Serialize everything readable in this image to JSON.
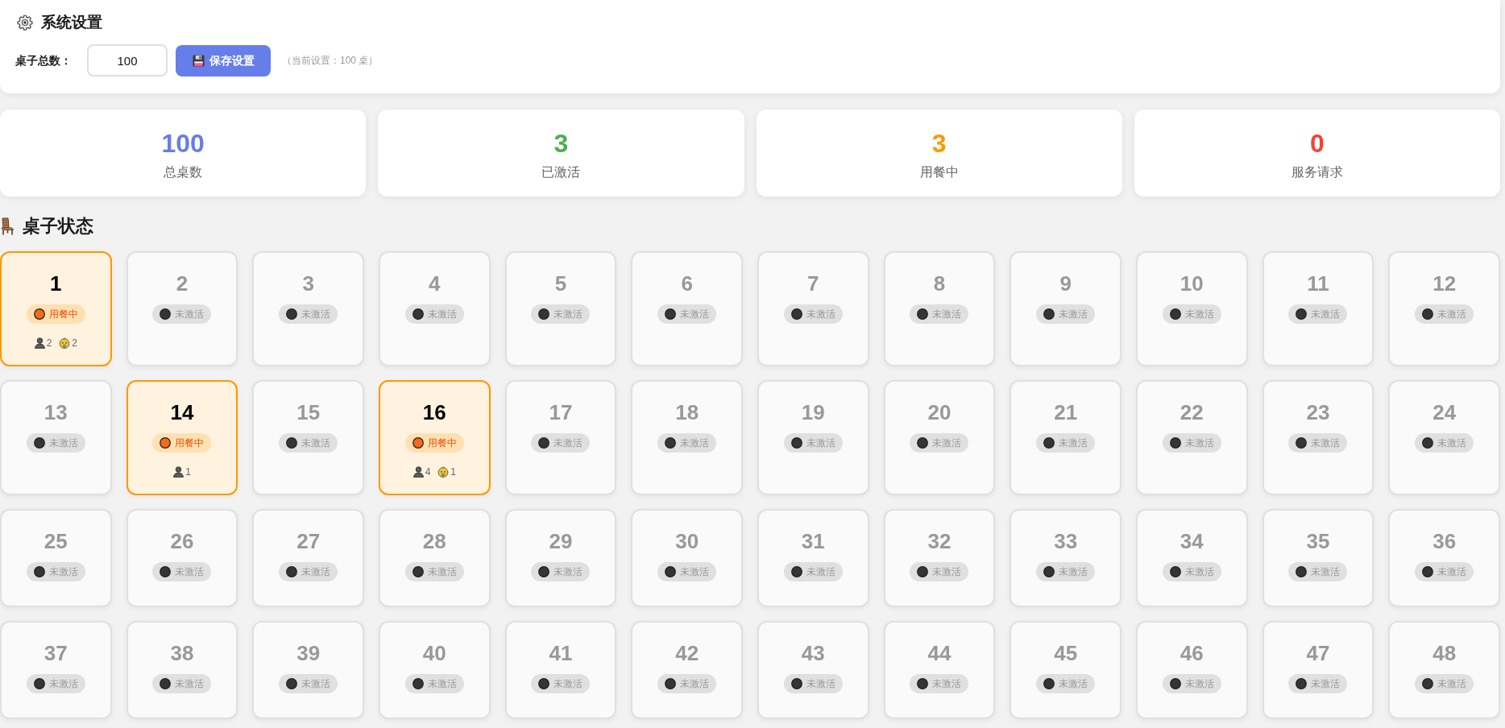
{
  "settings": {
    "title": "系统设置",
    "field_label": "桌子总数：",
    "field_value": "100",
    "save_button": "保存设置",
    "note": "（当前设置：100 桌）"
  },
  "stats": [
    {
      "value": "100",
      "label": "总桌数",
      "color": "#667eea"
    },
    {
      "value": "3",
      "label": "已激活",
      "color": "#4caf50"
    },
    {
      "value": "3",
      "label": "用餐中",
      "color": "#ff9800"
    },
    {
      "value": "0",
      "label": "服务请求",
      "color": "#f44336"
    }
  ],
  "tables_section": {
    "title": "桌子状态"
  },
  "tables": [
    {
      "number": "1",
      "kind": "occupied",
      "status_label": "用餐中",
      "guests": [
        {
          "kind": "adult",
          "count": "2"
        },
        {
          "kind": "child",
          "count": "2"
        }
      ]
    },
    {
      "number": "2",
      "kind": "inactive",
      "status_label": "未激活"
    },
    {
      "number": "3",
      "kind": "inactive",
      "status_label": "未激活"
    },
    {
      "number": "4",
      "kind": "inactive",
      "status_label": "未激活"
    },
    {
      "number": "5",
      "kind": "inactive",
      "status_label": "未激活"
    },
    {
      "number": "6",
      "kind": "inactive",
      "status_label": "未激活"
    },
    {
      "number": "7",
      "kind": "inactive",
      "status_label": "未激活"
    },
    {
      "number": "8",
      "kind": "inactive",
      "status_label": "未激活"
    },
    {
      "number": "9",
      "kind": "inactive",
      "status_label": "未激活"
    },
    {
      "number": "10",
      "kind": "inactive",
      "status_label": "未激活"
    },
    {
      "number": "11",
      "kind": "inactive",
      "status_label": "未激活"
    },
    {
      "number": "12",
      "kind": "inactive",
      "status_label": "未激活"
    },
    {
      "number": "13",
      "kind": "inactive",
      "status_label": "未激活"
    },
    {
      "number": "14",
      "kind": "occupied",
      "status_label": "用餐中",
      "guests": [
        {
          "kind": "adult",
          "count": "1"
        }
      ]
    },
    {
      "number": "15",
      "kind": "inactive",
      "status_label": "未激活"
    },
    {
      "number": "16",
      "kind": "occupied",
      "status_label": "用餐中",
      "guests": [
        {
          "kind": "adult",
          "count": "4"
        },
        {
          "kind": "child",
          "count": "1"
        }
      ]
    },
    {
      "number": "17",
      "kind": "inactive",
      "status_label": "未激活"
    },
    {
      "number": "18",
      "kind": "inactive",
      "status_label": "未激活"
    },
    {
      "number": "19",
      "kind": "inactive",
      "status_label": "未激活"
    },
    {
      "number": "20",
      "kind": "inactive",
      "status_label": "未激活"
    },
    {
      "number": "21",
      "kind": "inactive",
      "status_label": "未激活"
    },
    {
      "number": "22",
      "kind": "inactive",
      "status_label": "未激活"
    },
    {
      "number": "23",
      "kind": "inactive",
      "status_label": "未激活"
    },
    {
      "number": "24",
      "kind": "inactive",
      "status_label": "未激活"
    },
    {
      "number": "25",
      "kind": "inactive",
      "status_label": "未激活"
    },
    {
      "number": "26",
      "kind": "inactive",
      "status_label": "未激活"
    },
    {
      "number": "27",
      "kind": "inactive",
      "status_label": "未激活"
    },
    {
      "number": "28",
      "kind": "inactive",
      "status_label": "未激活"
    },
    {
      "number": "29",
      "kind": "inactive",
      "status_label": "未激活"
    },
    {
      "number": "30",
      "kind": "inactive",
      "status_label": "未激活"
    },
    {
      "number": "31",
      "kind": "inactive",
      "status_label": "未激活"
    },
    {
      "number": "32",
      "kind": "inactive",
      "status_label": "未激活"
    },
    {
      "number": "33",
      "kind": "inactive",
      "status_label": "未激活"
    },
    {
      "number": "34",
      "kind": "inactive",
      "status_label": "未激活"
    },
    {
      "number": "35",
      "kind": "inactive",
      "status_label": "未激活"
    },
    {
      "number": "36",
      "kind": "inactive",
      "status_label": "未激活"
    },
    {
      "number": "37",
      "kind": "inactive",
      "status_label": "未激活"
    },
    {
      "number": "38",
      "kind": "inactive",
      "status_label": "未激活"
    },
    {
      "number": "39",
      "kind": "inactive",
      "status_label": "未激活"
    },
    {
      "number": "40",
      "kind": "inactive",
      "status_label": "未激活"
    },
    {
      "number": "41",
      "kind": "inactive",
      "status_label": "未激活"
    },
    {
      "number": "42",
      "kind": "inactive",
      "status_label": "未激活"
    },
    {
      "number": "43",
      "kind": "inactive",
      "status_label": "未激活"
    },
    {
      "number": "44",
      "kind": "inactive",
      "status_label": "未激活"
    },
    {
      "number": "45",
      "kind": "inactive",
      "status_label": "未激活"
    },
    {
      "number": "46",
      "kind": "inactive",
      "status_label": "未激活"
    },
    {
      "number": "47",
      "kind": "inactive",
      "status_label": "未激活"
    },
    {
      "number": "48",
      "kind": "inactive",
      "status_label": "未激活"
    }
  ]
}
